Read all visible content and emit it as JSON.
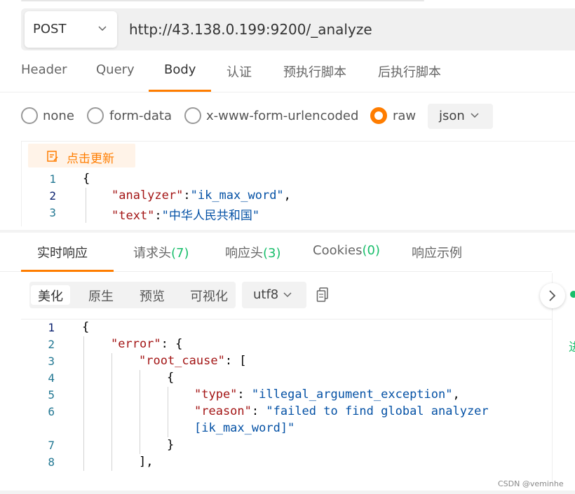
{
  "request": {
    "method": "POST",
    "url": "http://43.138.0.199:9200/_analyze"
  },
  "request_tabs": [
    "Header",
    "Query",
    "Body",
    "认证",
    "预执行脚本",
    "后执行脚本"
  ],
  "active_request_tab": "Body",
  "body_types": [
    "none",
    "form-data",
    "x-www-form-urlencoded",
    "raw"
  ],
  "selected_body_type": "raw",
  "raw_format": "json",
  "update_button_label": "点击更新",
  "request_code": {
    "line_numbers": [
      "1",
      "2",
      "3"
    ],
    "open_brace": "{",
    "line2_key": "\"analyzer\"",
    "line2_sep": ":",
    "line2_value": "\"ik_max_word\"",
    "line2_end": ",",
    "line3_key": "\"text\"",
    "line3_sep": ":",
    "line3_value": "\"中华人民共和国\""
  },
  "response_tabs": [
    {
      "label": "实时响应",
      "count": ""
    },
    {
      "label": "请求头",
      "count": "(7)"
    },
    {
      "label": "响应头",
      "count": "(3)"
    },
    {
      "label": "Cookies",
      "count": "(0)"
    },
    {
      "label": "响应示例",
      "count": ""
    }
  ],
  "active_response_tab": "实时响应",
  "view_modes": [
    "美化",
    "原生",
    "预览",
    "可视化"
  ],
  "active_view_mode": "美化",
  "encoding": "utf8",
  "side_panel_glyph": "进",
  "response_code": {
    "line_numbers": [
      "1",
      "2",
      "3",
      "4",
      "5",
      "6",
      "",
      "7",
      "8"
    ],
    "l1": "{",
    "l2_key": "\"error\"",
    "l2_rest": ": {",
    "l3_key": "\"root_cause\"",
    "l3_rest": ": [",
    "l4": "{",
    "l5_key": "\"type\"",
    "l5_sep": ": ",
    "l5_value": "\"illegal_argument_exception\"",
    "l5_end": ",",
    "l6_key": "\"reason\"",
    "l6_sep": ": ",
    "l6_value": "\"failed to find global analyzer",
    "l6_cont": "[ik_max_word]\"",
    "l7": "}",
    "l8": "],"
  },
  "watermark": "CSDN @veminhe",
  "colors": {
    "accent": "#ff7d00",
    "count_green": "#19be6b",
    "json_key": "#a31515",
    "json_string": "#0451a5",
    "line_number": "#237893"
  }
}
